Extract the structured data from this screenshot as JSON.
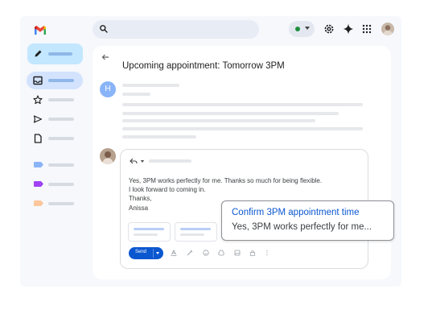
{
  "email": {
    "subject": "Upcoming appointment: Tomorrow 3PM",
    "sender_initial": "H"
  },
  "reply": {
    "lines": [
      "Yes, 3PM works perfectly for me. Thanks so much for being flexible.",
      "I look forward to coming in.",
      "Thanks,",
      "Anissa"
    ],
    "send_label": "Send"
  },
  "suggestion": {
    "title": "Confirm 3PM appointment time",
    "preview": "Yes, 3PM works perfectly for me..."
  },
  "colors": {
    "accent": "#0b57d0",
    "compose_bg": "#c2e7ff",
    "status_green": "#1e8e3e"
  },
  "icons": {
    "header": [
      "search-icon",
      "status-indicator",
      "settings-icon",
      "gemini-sparkle-icon",
      "apps-grid-icon",
      "account-avatar"
    ],
    "nav": [
      "inbox-icon",
      "starred-icon",
      "sent-icon",
      "drafts-icon"
    ],
    "labels": [
      "label-blue",
      "label-purple",
      "label-orange"
    ]
  }
}
